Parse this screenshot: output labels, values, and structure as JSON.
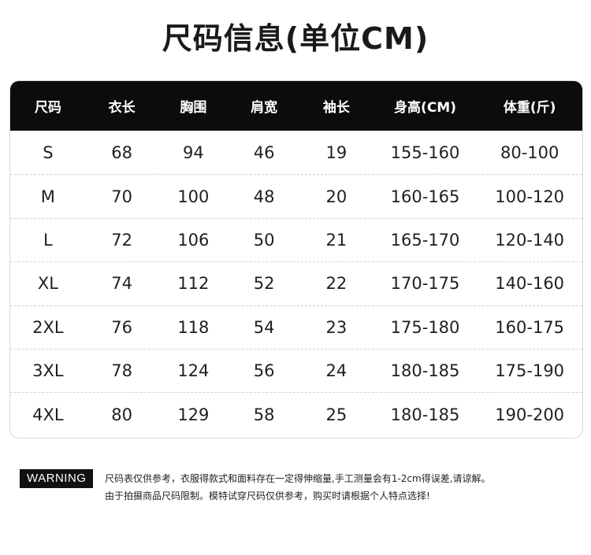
{
  "title": "尺码信息(单位CM)",
  "table": {
    "headers": [
      "尺码",
      "衣长",
      "胸围",
      "肩宽",
      "袖长",
      "身高(CM)",
      "体重(斤)"
    ],
    "rows": [
      [
        "S",
        "68",
        "94",
        "46",
        "19",
        "155-160",
        "80-100"
      ],
      [
        "M",
        "70",
        "100",
        "48",
        "20",
        "160-165",
        "100-120"
      ],
      [
        "L",
        "72",
        "106",
        "50",
        "21",
        "165-170",
        "120-140"
      ],
      [
        "XL",
        "74",
        "112",
        "52",
        "22",
        "170-175",
        "140-160"
      ],
      [
        "2XL",
        "76",
        "118",
        "54",
        "23",
        "175-180",
        "160-175"
      ],
      [
        "3XL",
        "78",
        "124",
        "56",
        "24",
        "180-185",
        "175-190"
      ],
      [
        "4XL",
        "80",
        "129",
        "58",
        "25",
        "180-185",
        "190-200"
      ]
    ]
  },
  "warning": {
    "label": "WARNING",
    "line1": "尺码表仅供参考，衣服得款式和面料存在一定得伸缩量,手工测量会有1-2cm得误差,请谅解。",
    "line2": "由于拍摄商品尺码限制。模特试穿尺码仅供参考，购买时请根据个人特点选择!"
  }
}
